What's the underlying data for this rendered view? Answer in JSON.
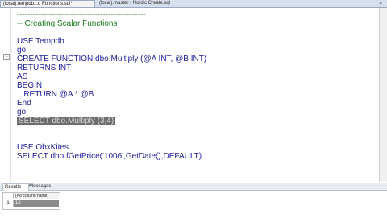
{
  "tabs": [
    {
      "label": "(local).tempdb...d Functions.sql*"
    },
    {
      "label": "(local).master - Nordic Create.sql"
    }
  ],
  "tab_close_glyph": "×",
  "code_lines": [
    {
      "text": "------------------------------------------------",
      "kind": "comment"
    },
    {
      "text": "-- Creating Scalar Functions",
      "kind": "comment"
    },
    {
      "text": "",
      "kind": "code"
    },
    {
      "text": "USE Tempdb",
      "kind": "code"
    },
    {
      "text": "go",
      "kind": "code"
    },
    {
      "text": "CREATE FUNCTION dbo.Multiply (@A INT, @B INT)",
      "kind": "code"
    },
    {
      "text": "RETURNS INT",
      "kind": "code"
    },
    {
      "text": "AS",
      "kind": "code"
    },
    {
      "text": "BEGIN",
      "kind": "code"
    },
    {
      "text": "   RETURN @A * @B",
      "kind": "code"
    },
    {
      "text": "End",
      "kind": "code"
    },
    {
      "text": "go",
      "kind": "code"
    },
    {
      "text": "SELECT dbo.Multiply (3,4)",
      "kind": "selected"
    },
    {
      "text": "",
      "kind": "code"
    },
    {
      "text": "",
      "kind": "code"
    },
    {
      "text": "USE ObxKites",
      "kind": "code"
    },
    {
      "text": "SELECT dbo.fGetPrice('1006',GetDate(),DEFAULT)",
      "kind": "code"
    }
  ],
  "results": {
    "tabs": [
      "Results",
      "Messages"
    ],
    "header": "(No column name)",
    "rows": [
      {
        "num": "1",
        "value": "12"
      }
    ]
  },
  "colors": {
    "keyword": "#1c1c9c",
    "comment": "#1a7a1a",
    "selection": "#6d6d6d"
  }
}
